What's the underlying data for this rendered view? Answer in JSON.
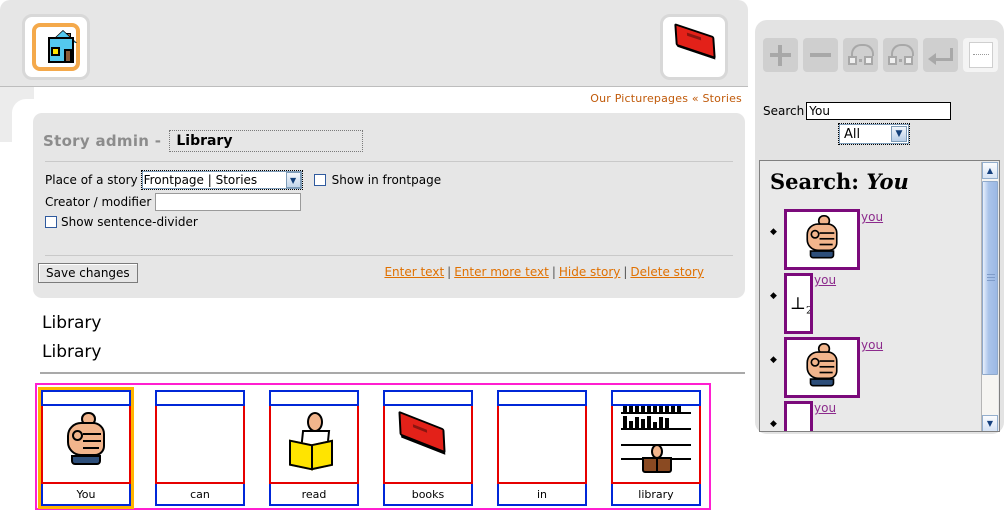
{
  "header": {
    "home_icon": "house-icon",
    "book_icon": "book-icon",
    "breadcrumb_site": "Our Picturepages",
    "breadcrumb_sep": "«",
    "breadcrumb_section": "Stories"
  },
  "admin": {
    "title_label": "Story admin -",
    "story_title_value": "Library",
    "place_label": "Place of a story",
    "place_value": "Frontpage | Stories",
    "place_options": [
      "Frontpage | Stories"
    ],
    "show_in_frontpage_label": "Show in frontpage",
    "show_in_frontpage_checked": false,
    "creator_label": "Creator / modifier",
    "creator_value": "",
    "show_divider_label": "Show sentence-divider",
    "show_divider_checked": false,
    "save_label": "Save changes",
    "links": [
      "Enter text",
      "Enter more text",
      "Hide story",
      "Delete story"
    ],
    "link_sep": "|"
  },
  "story": {
    "heading_1": "Library",
    "heading_2": "Library",
    "cards": [
      {
        "label": "You",
        "icon": "fist-pictogram",
        "selected": true
      },
      {
        "label": "can",
        "icon": "blank-pictogram",
        "selected": false
      },
      {
        "label": "read",
        "icon": "reader-pictogram",
        "selected": false
      },
      {
        "label": "books",
        "icon": "red-book-pictogram",
        "selected": false
      },
      {
        "label": "in",
        "icon": "blank-pictogram",
        "selected": false
      },
      {
        "label": "library",
        "icon": "shelves-pictogram",
        "selected": false
      }
    ]
  },
  "sidebar": {
    "toolbar": [
      {
        "name": "add-symbol-button",
        "icon": "plus-icon",
        "disabled": true
      },
      {
        "name": "remove-symbol-button",
        "icon": "minus-icon",
        "disabled": true
      },
      {
        "name": "move-left-button",
        "icon": "swap-left-icon",
        "disabled": true
      },
      {
        "name": "move-right-button",
        "icon": "swap-right-icon",
        "disabled": true
      },
      {
        "name": "line-break-button",
        "icon": "enter-arrow-icon",
        "disabled": true
      },
      {
        "name": "blank-card-button",
        "icon": "blank-card-icon",
        "disabled": false
      }
    ],
    "search_label": "Search",
    "search_value": "You",
    "search_placeholder": "",
    "scope_value": "All",
    "scope_options": [
      "All"
    ],
    "results_title_prefix": "Search:",
    "results_query": "You",
    "results": [
      {
        "label": "you",
        "thumb": "fist-pictogram",
        "size": "big"
      },
      {
        "label": "you",
        "thumb": "perpendicular-symbol",
        "size": "small"
      },
      {
        "label": "you",
        "thumb": "fist-pictogram",
        "size": "big"
      },
      {
        "label": "you",
        "thumb": "blank-pictogram",
        "size": "small"
      }
    ],
    "scrollbar": {
      "up": "▲",
      "down": "▼"
    }
  },
  "colors": {
    "accent_link": "#e07000",
    "panel_bg": "#e6e6e6",
    "strip_border": "#ff1fd0",
    "card_top_border": "#0027d8",
    "card_img_border": "#e60000",
    "selected_outline": "#ffb400",
    "result_purple": "#7b0a7b"
  }
}
